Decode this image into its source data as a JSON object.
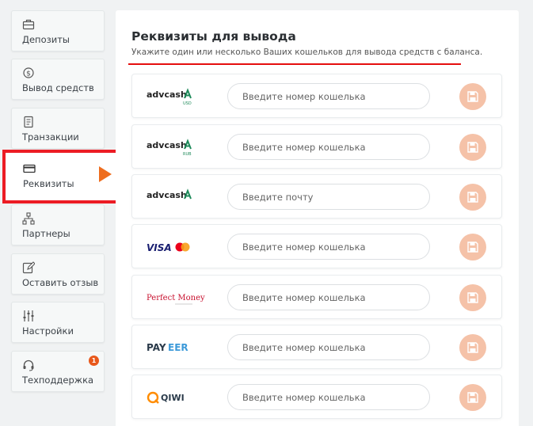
{
  "sidebar": {
    "items": [
      {
        "id": "deposits",
        "label": "Депозиты",
        "icon": "briefcase-icon"
      },
      {
        "id": "withdraw",
        "label": "Вывод средств",
        "icon": "money-out-icon"
      },
      {
        "id": "transactions",
        "label": "Транзакции",
        "icon": "document-icon"
      },
      {
        "id": "requisites",
        "label": "Реквизиты",
        "icon": "credit-card-icon",
        "active": true
      },
      {
        "id": "partners",
        "label": "Партнеры",
        "icon": "network-icon"
      },
      {
        "id": "review",
        "label": "Оставить отзыв",
        "icon": "edit-icon"
      },
      {
        "id": "settings",
        "label": "Настройки",
        "icon": "sliders-icon"
      },
      {
        "id": "support",
        "label": "Техподдержка",
        "icon": "headset-icon",
        "badge": "1"
      }
    ]
  },
  "main": {
    "title": "Реквизиты для вывода",
    "subtitle": "Укажите один или несколько Ваших кошельков для вывода средств с баланса.",
    "wallets": [
      {
        "logo_text": "advcash",
        "logo_sub": "USD",
        "placeholder": "Введите номер кошелька"
      },
      {
        "logo_text": "advcash",
        "logo_sub": "RUB",
        "placeholder": "Введите номер кошелька"
      },
      {
        "logo_text": "advcash",
        "logo_sub": "",
        "placeholder": "Введите почту"
      },
      {
        "logo_text": "VISA",
        "logo_sub": "",
        "placeholder": "Введите номер кошелька"
      },
      {
        "logo_text": "Perfect Money",
        "logo_sub": "",
        "placeholder": "Введите номер кошелька"
      },
      {
        "logo_text": "PAY",
        "logo_text2": "EER",
        "placeholder": "Введите номер кошелька"
      },
      {
        "logo_text": "QIWI",
        "logo_sub": "",
        "placeholder": "Введите номер кошелька"
      }
    ]
  },
  "colors": {
    "accent": "#ee6d1e",
    "highlight": "#ec1c24",
    "save_button": "#f5c2a8",
    "advcash_green": "#1e8a5a",
    "visa_blue": "#1a1f71",
    "perfect_money_red": "#c8102e",
    "payeer_blue": "#3d9ad9",
    "qiwi_orange": "#ff8c00"
  }
}
